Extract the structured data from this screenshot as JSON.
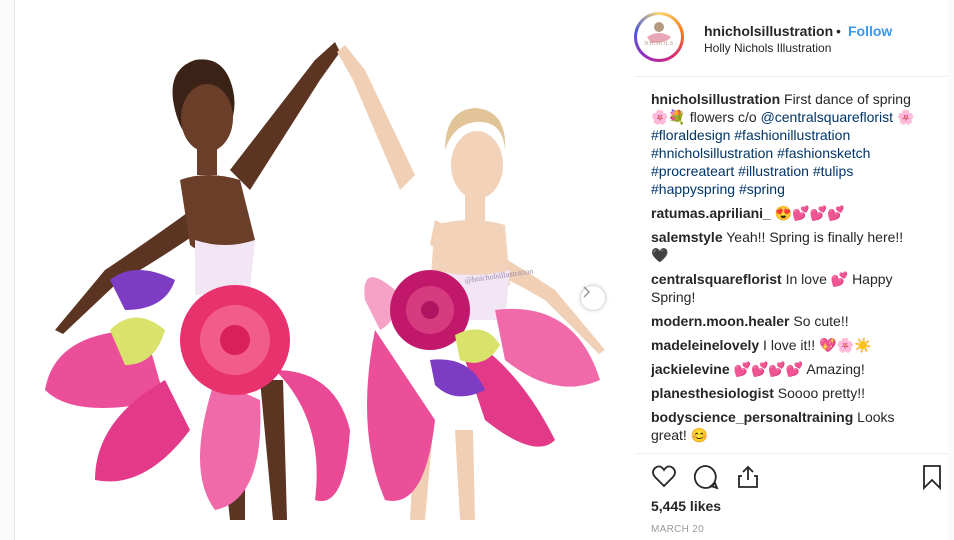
{
  "post": {
    "account": {
      "username": "hnicholsillustration",
      "separator": "•",
      "follow_label": "Follow",
      "full_name": "Holly Nichols Illustration",
      "avatar_text": "NICHOLS"
    },
    "watermark": "@hnicholsillustration",
    "caption": {
      "username": "hnicholsillustration",
      "text_parts": [
        {
          "type": "text",
          "value": " First dance of spring 🌸💐 flowers c/o "
        },
        {
          "type": "link",
          "value": "@centralsquareflorist"
        },
        {
          "type": "text",
          "value": " 🌸 "
        },
        {
          "type": "link",
          "value": "#floraldesign #fashionillustration #hnicholsillustration #fashionsketch #procreateart #illustration #tulips #happyspring #spring"
        }
      ]
    },
    "comments": [
      {
        "user": "ratumas.apriliani_",
        "text": " 😍💕💕💕"
      },
      {
        "user": "salemstyle",
        "text": " Yeah!! Spring is finally here!! 🖤"
      },
      {
        "user": "centralsquareflorist",
        "text": " In love 💕 Happy Spring!"
      },
      {
        "user": "modern.moon.healer",
        "text": " So cute!!"
      },
      {
        "user": "madeleinelovely",
        "text": " I love it!! 💖🌸☀️"
      },
      {
        "user": "jackielevine",
        "text": " 💕💕💕💕 Amazing!"
      },
      {
        "user": "planesthesiologist",
        "text": " Soooo pretty!!"
      },
      {
        "user": "bodyscience_personaltraining",
        "text": " Looks great! 😊"
      }
    ],
    "likes": "5,445 likes",
    "date": "MARCH 20",
    "icons": [
      "heart-icon",
      "comment-icon",
      "share-icon",
      "bookmark-icon",
      "chevron-right-icon"
    ],
    "colors": {
      "follow": "#3897f0",
      "link": "#003569",
      "petal_pink": "#ec4f9a",
      "rose": "#e8326e",
      "statice": "#7d3cc4"
    }
  }
}
